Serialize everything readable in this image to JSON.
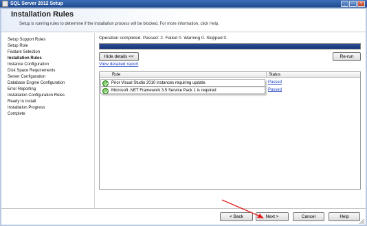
{
  "window": {
    "title": "SQL Server 2012 Setup"
  },
  "header": {
    "title": "Installation Rules",
    "subtitle": "Setup is running rules to determine if the installation process will be blocked. For more information, click Help."
  },
  "nav": {
    "items": [
      {
        "label": "Setup Support Rules"
      },
      {
        "label": "Setup Role"
      },
      {
        "label": "Feature Selection"
      },
      {
        "label": "Installation Rules",
        "active": true
      },
      {
        "label": "Instance Configuration"
      },
      {
        "label": "Disk Space Requirements"
      },
      {
        "label": "Server Configuration"
      },
      {
        "label": "Database Engine Configuration"
      },
      {
        "label": "Error Reporting"
      },
      {
        "label": "Installation Configuration Rules"
      },
      {
        "label": "Ready to Install"
      },
      {
        "label": "Installation Progress"
      },
      {
        "label": "Complete"
      }
    ]
  },
  "main": {
    "status_text": "Operation completed. Passed: 2.   Failed 0.   Warning 0.   Skipped 0.",
    "progress": 1.0,
    "hide_details_label": "Hide details <<",
    "rerun_label": "Re-run",
    "view_report_label": "View detailed report",
    "table": {
      "columns": {
        "rule": "Rule",
        "status": "Status"
      },
      "rows": [
        {
          "rule": "Prior Visual Studio 2010 instances requiring update.",
          "status": "Passed"
        },
        {
          "rule": "Microsoft .NET Framework 3.5 Service Pack 1 is required",
          "status": "Passed"
        }
      ]
    }
  },
  "footer": {
    "back_label": "< Back",
    "next_label": "Next >",
    "cancel_label": "Cancel",
    "help_label": "Help"
  },
  "colors": {
    "titlebar": "#20488c",
    "progress_fill": "#17347a",
    "link": "#1a3fc4",
    "annotation_arrow": "#e02020",
    "check": "#2f9a1f"
  },
  "icons": {
    "app": "sql-setup-icon",
    "row_status": "check-circle-icon"
  }
}
